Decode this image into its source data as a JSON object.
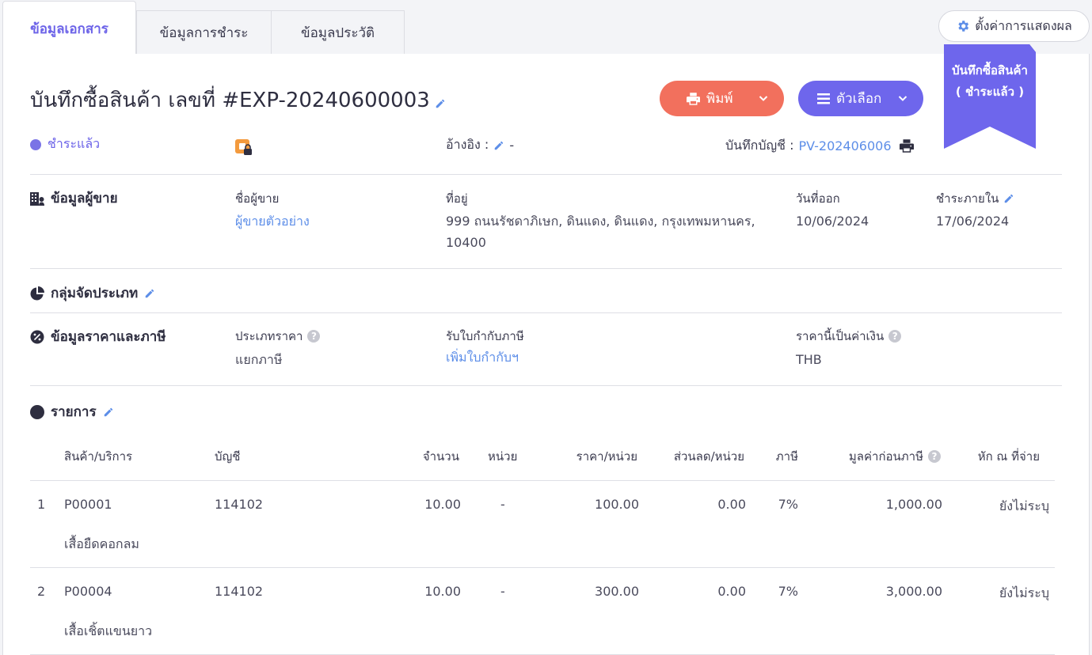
{
  "tabs": [
    {
      "label": "ข้อมูลเอกสาร",
      "active": true
    },
    {
      "label": "ข้อมูลการชำระ",
      "active": false
    },
    {
      "label": "ข้อมูลประวัติ",
      "active": false
    }
  ],
  "settings_button": {
    "label": "ตั้งค่าการแสดงผล",
    "icon": "gear-icon"
  },
  "ribbon": {
    "line1": "บันทึกซื้อสินค้า",
    "line2": "( ชำระแล้ว )",
    "color": "#6e66ec"
  },
  "header": {
    "title": "บันทึกซื้อสินค้า เลขที่ #EXP-20240600003",
    "print_label": "พิมพ์",
    "options_label": "ตัวเลือก"
  },
  "status": {
    "label": "ชำระแล้ว",
    "color": "#7a73e6"
  },
  "reference": {
    "label": "อ้างอิง :",
    "value": "-"
  },
  "accounting": {
    "label": "บันทึกบัญชี :",
    "value": "PV-202406006"
  },
  "vendor_section": {
    "title": "ข้อมูลผู้ขาย",
    "name_label": "ชื่อผู้ขาย",
    "name_value": "ผู้ขายตัวอย่าง",
    "address_label": "ที่อยู่",
    "address_line1": "999 ถนนรัชดาภิเษก, ดินแดง, ดินแดง, กรุงเทพมหานคร,",
    "address_line2": "10400",
    "issue_date_label": "วันที่ออก",
    "issue_date_value": "10/06/2024",
    "due_date_label": "ชำระภายใน",
    "due_date_value": "17/06/2024"
  },
  "category_section": {
    "title": "กลุ่มจัดประเภท"
  },
  "price_tax_section": {
    "title": "ข้อมูลราคาและภาษี",
    "price_type_label": "ประเภทราคา",
    "price_type_value": "แยกภาษี",
    "tax_invoice_label": "รับใบกำกับภาษี",
    "tax_invoice_value": "เพิ่มใบกำกับฯ",
    "currency_label": "ราคานี้เป็นค่าเงิน",
    "currency_value": "THB"
  },
  "items_section": {
    "title": "รายการ",
    "columns": {
      "product": "สินค้า/บริการ",
      "account": "บัญชี",
      "qty": "จำนวน",
      "unit": "หน่วย",
      "unit_price": "ราคา/หน่วย",
      "discount": "ส่วนลด/หน่วย",
      "tax": "ภาษี",
      "pre_tax": "มูลค่าก่อนภาษี",
      "withholding": "หัก ณ ที่จ่าย"
    },
    "rows": [
      {
        "no": "1",
        "code": "P00001",
        "name": "เสื้อยืดคอกลม",
        "account": "114102",
        "qty": "10.00",
        "unit": "-",
        "unit_price": "100.00",
        "discount": "0.00",
        "tax": "7%",
        "pre_tax": "1,000.00",
        "withholding": "ยังไม่ระบุ"
      },
      {
        "no": "2",
        "code": "P00004",
        "name": "เสื้อเชิ้ตแขนยาว",
        "account": "114102",
        "qty": "10.00",
        "unit": "-",
        "unit_price": "300.00",
        "discount": "0.00",
        "tax": "7%",
        "pre_tax": "3,000.00",
        "withholding": "ยังไม่ระบุ"
      }
    ]
  }
}
